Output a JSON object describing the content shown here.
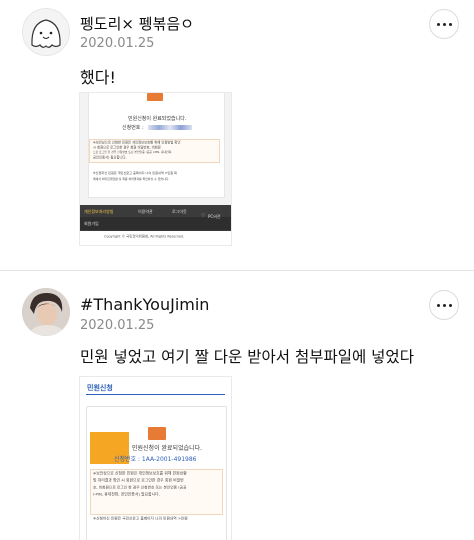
{
  "posts": [
    {
      "author": "펭도리× 펭볶음ㅇ",
      "date": "2020.01.25",
      "text": "했다!",
      "avatar_icon": "ghost-character-icon",
      "screenshot": {
        "complete_msg": "민원신청이 완료되었습니다.",
        "apply_no_label": "신청번호 :",
        "note_1": "※보안상으로 신청한 민원은 개인정보보호를 위해 인증방법 확인",
        "note_2": "시 회원으로 로그인한 경우 회원 비밀번호, 비회원",
        "note_3": "으로 로그인 한 경우 신청번호 또는 본인인증 (공공 I-PIN, 휴대전화,",
        "note_4": "공인인증서) 필요합니다.",
        "note_5": "※신청하신 민원은 국민신문고 홈페이지 나의 민원내역 >민원 목",
        "note_6": "록에서 처리진행현황 및 최종 처리결과를 확인하실 수 있습니다.",
        "footer_links": [
          "개인정보처리방침",
          "이용약관",
          "로그아웃"
        ],
        "footer_link_2": "회원가입",
        "pc_label": "PC버전",
        "copyright": "Copyright © 국민권익위원회, All Rights Reserved."
      }
    },
    {
      "author": "#ThankYouJimin",
      "date": "2020.01.25",
      "text": "민원 넣었고 여기 짤 다운 받아서 첨부파일에 넣었다",
      "avatar_icon": "person-photo-icon",
      "screenshot": {
        "header": "민원신청",
        "complete_msg": "민원신청이 완료되었습니다.",
        "apply_no": "신청번호 : 1AA-2001-491986",
        "note_1": "※보안상으로 신청한 민원은 개인정보보호를 위해 민원상황",
        "note_2": "및 처리결과 확인 시 회원으로 로그인한 경우 회원 비밀번",
        "note_3": "호, 비회원으로 로그인 한 경우 신청번호 또는 본인인증 (공공",
        "note_4": "I-PIN, 휴대전화, 공인인증서) 필요합니다.",
        "note_5": "※신청하신 민원은 국민신문고 홈페이지 나의 민원내역 >민원"
      }
    }
  ],
  "more_icon": "more-options-icon",
  "colors": {
    "stamp_orange": "#e77a34",
    "highlight_orange": "#f5a623",
    "link_blue": "#2c5fb8",
    "date_gray": "#8a8a8a"
  }
}
